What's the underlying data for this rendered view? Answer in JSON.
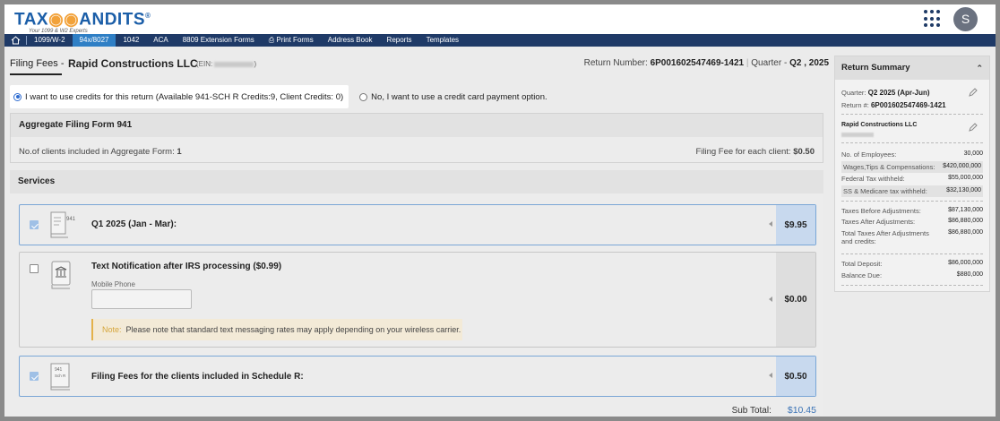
{
  "brand": {
    "name": "TAXBANDITS",
    "name_left": "TAX",
    "name_owl": "◉◉",
    "name_right": "ANDITS",
    "registered": "®",
    "tagline": "Your 1099 & W2 Experts"
  },
  "user": {
    "initial": "S"
  },
  "nav": {
    "items": [
      "1099/W-2",
      "94x/8027",
      "1042",
      "ACA",
      "8809 Extension Forms",
      "⎙ Print Forms",
      "Address Book",
      "Reports",
      "Templates"
    ],
    "active_index": 1
  },
  "header": {
    "filing_fees_label": "Filing Fees -",
    "company": "Rapid Constructions LLC",
    "ein_label": "(EIN:",
    "ein_close": ")",
    "return_number_label": "Return Number:",
    "return_number": "6P001602547469-1421",
    "quarter_label": "Quarter -",
    "quarter": "Q2 , 2025"
  },
  "payment_options": {
    "credits_label": "I want to use credits for this return (Available 941-SCH R Credits:9, Client Credits: 0)",
    "card_label": "No, I want to use a credit card payment option.",
    "selected": "credits"
  },
  "aggregate": {
    "title": "Aggregate Filing Form 941",
    "clients_label": "No.of clients included in Aggregate Form:",
    "clients_count": "1",
    "fee_label": "Filing Fee for each client:",
    "fee_value": "$0.50"
  },
  "services": {
    "title": "Services",
    "items": [
      {
        "title": "Q1 2025 (Jan - Mar):",
        "price": "$9.95",
        "checked": true,
        "icon_label": "941"
      },
      {
        "title": "Text Notification after IRS processing ($0.99)",
        "price": "$0.00",
        "checked": false,
        "mobile_label": "Mobile Phone",
        "mobile_value": "",
        "note_label": "Note:",
        "note_text": "Please note that standard text messaging rates may apply depending on your wireless carrier."
      },
      {
        "title": "Filing Fees for the clients included in Schedule R:",
        "price": "$0.50",
        "checked": true,
        "icon_label_1": "941",
        "icon_label_2": "Sch R"
      }
    ],
    "subtotal_label": "Sub Total:",
    "subtotal_value": "$10.45"
  },
  "summary": {
    "title": "Return Summary",
    "quarter_label": "Quarter:",
    "quarter_value": "Q2 2025 (Apr-Jun)",
    "return_label": "Return #:",
    "return_value": "6P001602547469-1421",
    "company": "Rapid Constructions LLC",
    "rows": [
      {
        "label": "No. of Employees:",
        "value": "30,000",
        "hl": false
      },
      {
        "label": "Wages,Tips & Compensations:",
        "value": "$420,000,000",
        "hl": true
      },
      {
        "label": "Federal Tax withheld:",
        "value": "$55,000,000",
        "hl": false
      },
      {
        "label": "SS & Medicare tax withheld:",
        "value": "$32,130,000",
        "hl": true
      }
    ],
    "rows2": [
      {
        "label": "Taxes Before Adjustments:",
        "value": "$87,130,000"
      },
      {
        "label": "Taxes After Adjustments:",
        "value": "$86,880,000"
      },
      {
        "label": "Total Taxes After Adjustments and credits:",
        "value": "$86,880,000"
      }
    ],
    "rows3": [
      {
        "label": "Total Deposit:",
        "value": "$86,000,000"
      },
      {
        "label": "Balance Due:",
        "value": "$880,000"
      }
    ]
  }
}
